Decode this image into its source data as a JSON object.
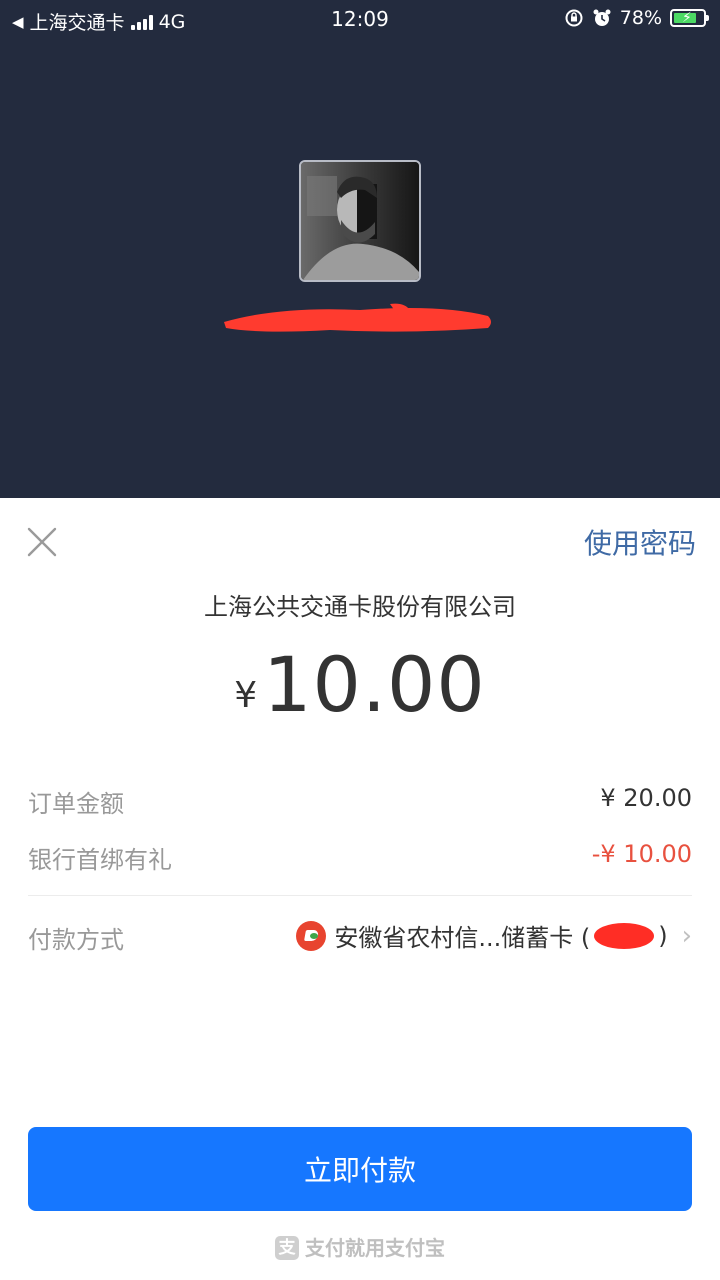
{
  "status_bar": {
    "back_app": "上海交通卡",
    "network": "4G",
    "time": "12:09",
    "battery": "78%"
  },
  "header": {
    "close_icon": "close-icon",
    "use_password": "使用密码"
  },
  "merchant": "上海公共交通卡股份有限公司",
  "amount": {
    "currency": "¥",
    "value": "10.00"
  },
  "details": [
    {
      "label": "订单金额",
      "value": "¥ 20.00"
    },
    {
      "label": "银行首绑有礼",
      "value": "-¥ 10.00"
    }
  ],
  "payment_method": {
    "label": "付款方式",
    "bank": "安徽省农村信...储蓄卡 (",
    "suffix": ")"
  },
  "pay_button": "立即付款",
  "footer": "支付就用支付宝",
  "colors": {
    "accent": "#1677ff",
    "discount": "#e8513f",
    "header_bg": "#232b3e",
    "link": "#3f6aa5"
  }
}
